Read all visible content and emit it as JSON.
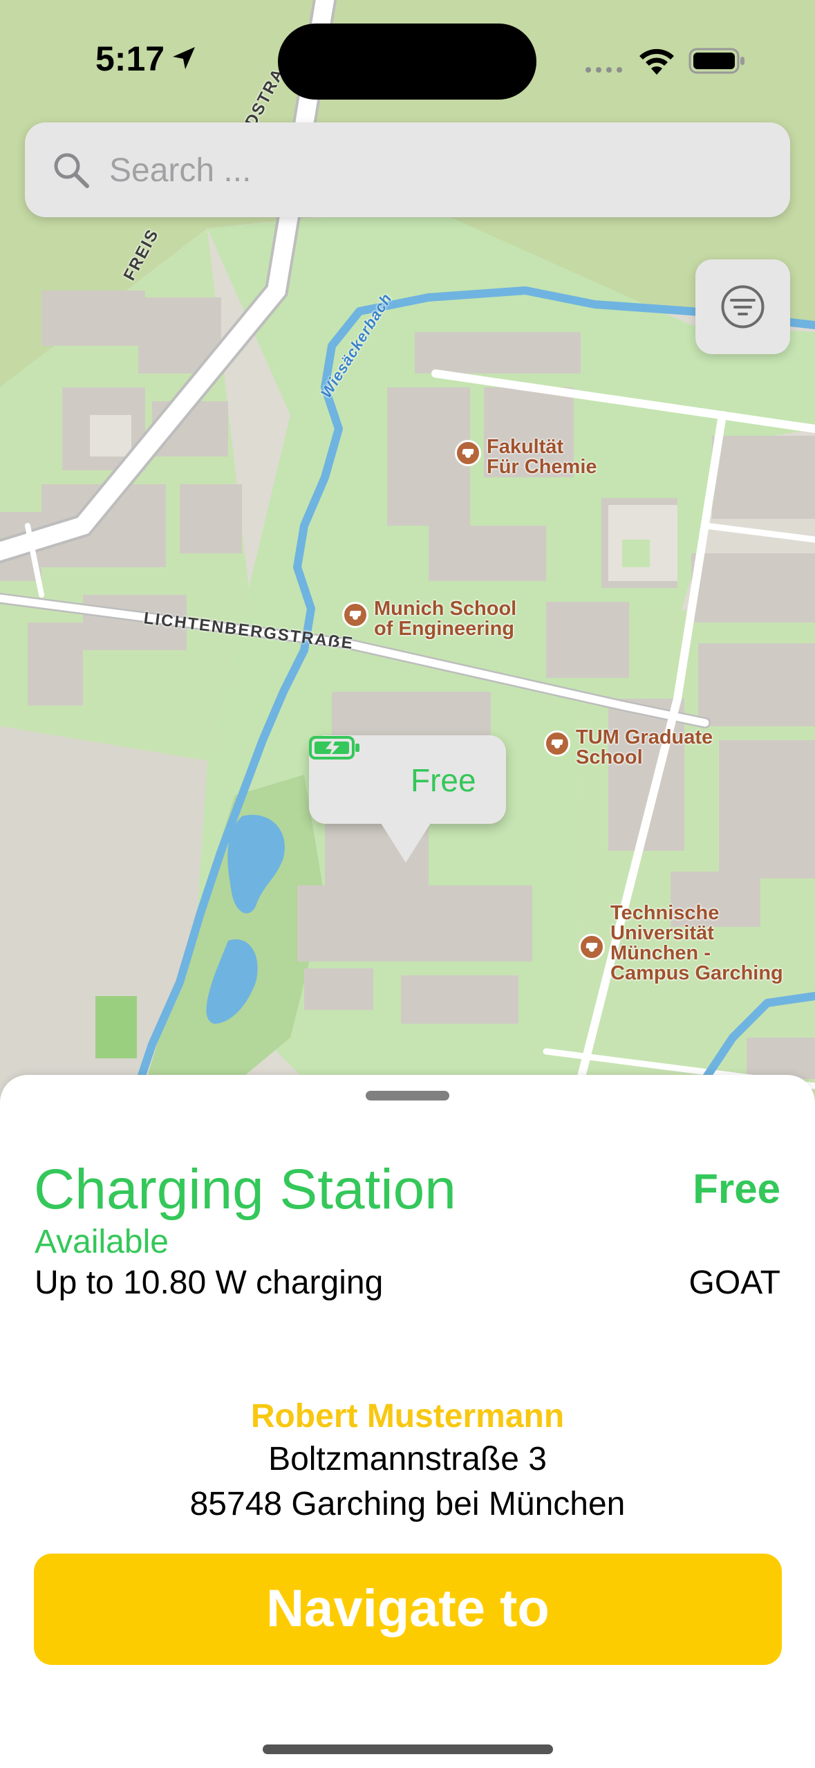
{
  "status_bar": {
    "time": "5:17",
    "location_icon": "location-arrow-icon",
    "wifi_icon": "wifi-icon",
    "battery_icon": "battery-full-icon",
    "signal_icon": "signal-dots-icon"
  },
  "search": {
    "placeholder": "Search ...",
    "icon": "magnifying-glass-icon"
  },
  "filter": {
    "icon": "filter-lines-icon"
  },
  "map": {
    "pois": [
      {
        "name": "Fakultät\nFür Chemie",
        "icon": "graduation-cap-icon"
      },
      {
        "name": "Munich School\nof Engineering",
        "icon": "graduation-cap-icon"
      },
      {
        "name": "TUM Graduate\nSchool",
        "icon": "graduation-cap-icon"
      },
      {
        "name": "Technische\nUniversität\nMünchen -\nCampus Garching",
        "icon": "graduation-cap-icon"
      }
    ],
    "streets": {
      "lichtenberg": "LICHTENBERGSTRAẞE",
      "freising_a": "FREIS",
      "freising_b": "DSTRA"
    },
    "waterway": "Wiesäckerbach",
    "callout": {
      "label": "Free",
      "icon": "battery-charging-icon"
    }
  },
  "station": {
    "title": "Charging Station",
    "price": "Free",
    "availability": "Available",
    "power": "Up to 10.80 W charging",
    "operator": "GOAT",
    "owner": "Robert Mustermann",
    "address_line1": "Boltzmannstraße 3",
    "address_line2": "85748 Garching bei München",
    "navigate_label": "Navigate to"
  },
  "colors": {
    "accent_green": "#34c759",
    "accent_yellow": "#fdcc00",
    "owner_yellow": "#f8c710",
    "map_green": "#c5e4b1",
    "map_building": "#cfcbc4",
    "map_water": "#6fb3e0"
  }
}
